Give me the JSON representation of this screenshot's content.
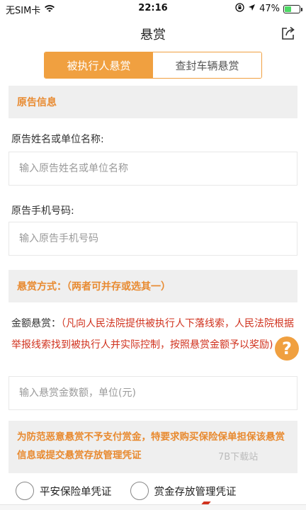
{
  "status_bar": {
    "carrier": "无SIM卡",
    "time": "22:16",
    "battery": "47%",
    "battery_level": 0.47,
    "icons": [
      "wifi-icon",
      "orientation-lock-icon",
      "location-icon",
      "battery-charging-icon"
    ]
  },
  "nav": {
    "title": "悬赏",
    "share_icon": "share-icon"
  },
  "tabs": [
    {
      "label": "被执行人悬赏",
      "active": true
    },
    {
      "label": "查封车辆悬赏",
      "active": false
    }
  ],
  "plaintiff": {
    "section_title": "原告信息",
    "name_label": "原告姓名或单位名称:",
    "name_placeholder": "输入原告姓名或单位名称",
    "phone_label": "原告手机号码:",
    "phone_placeholder": "输入原告手机号码"
  },
  "reward": {
    "section_title": "悬赏方式：（两者可并存或选其一）",
    "amount_label": "金额悬赏：",
    "amount_note": "（凡向人民法院提供被执行人下落线索，人民法院根据举报线索找到被执行人并实际控制，按照悬赏金额予以奖励)",
    "amount_placeholder": "输入悬赏金数额，单位(元)",
    "help_label": "?"
  },
  "notice": {
    "text": "为防范恶意悬赏不予支付赏金，特要求购买保险保单担保该悬赏信息或提交悬赏存放管理凭证"
  },
  "watermark": "7B下载站",
  "voucher_options": [
    {
      "label": "平安保险单凭证",
      "selected": false
    },
    {
      "label": "赏金存放管理凭证",
      "selected": false
    }
  ],
  "colors": {
    "accent": "#f0a040",
    "section_text": "#e88a30",
    "note_red": "#d0321e",
    "band_bg": "#efefef"
  }
}
